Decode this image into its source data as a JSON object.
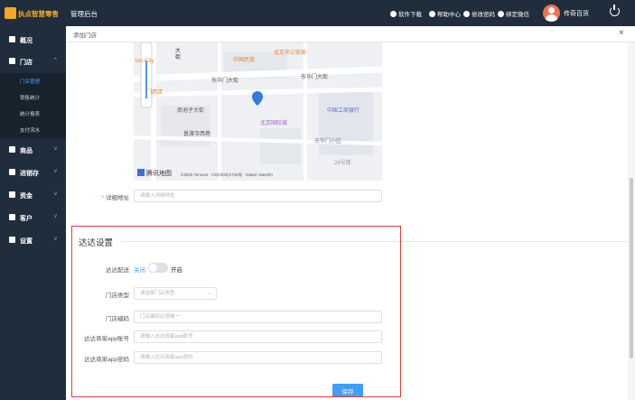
{
  "header": {
    "logo_text": "执点智慧零售",
    "title": "管理后台",
    "links": [
      {
        "label": "软件下载",
        "icon": "download-icon"
      },
      {
        "label": "帮助中心",
        "icon": "help-icon"
      },
      {
        "label": "修改密码",
        "icon": "edit-icon"
      },
      {
        "label": "绑定微信",
        "icon": "wechat-icon"
      }
    ],
    "username": "传奇百货"
  },
  "sidebar": {
    "items": [
      {
        "label": "概况",
        "icon": "home-icon"
      },
      {
        "label": "门店",
        "icon": "store-icon",
        "expanded": true,
        "chevron": "^"
      },
      {
        "label": "商品",
        "icon": "goods-icon",
        "chevron": "v"
      },
      {
        "label": "进销存",
        "icon": "inventory-icon",
        "chevron": "v"
      },
      {
        "label": "资金",
        "icon": "money-icon",
        "chevron": "v"
      },
      {
        "label": "客户",
        "icon": "customer-icon",
        "chevron": "v"
      },
      {
        "label": "设置",
        "icon": "settings-icon",
        "chevron": "v"
      }
    ],
    "subitems": [
      {
        "label": "门店管理",
        "active": true
      },
      {
        "label": "销售统计"
      },
      {
        "label": "统计报表"
      },
      {
        "label": "支付流水"
      }
    ]
  },
  "tab": {
    "label": "添加门店",
    "close": "×"
  },
  "map": {
    "labels": [
      "大",
      "街",
      "ton City",
      "门西店",
      "北京市公安局",
      "中国民族",
      "东华门大街",
      "东华门大街",
      "南池子大街",
      "普渡寺西巷",
      "中国工商银行",
      "北京国际城",
      "东华门小区",
      "24号楼"
    ],
    "brand": "腾讯地图",
    "copyright": "©2020 Tencent · GS(2020)1728号 · Data© NavInfo"
  },
  "form": {
    "address": {
      "label": "详细地址",
      "placeholder": "请输入详细地址"
    }
  },
  "dada": {
    "section_title": "达达设置",
    "delivery_label": "达达配送",
    "toggle_off": "关闭",
    "toggle_on": "开启",
    "store_type_label": "门店类型",
    "store_type_placeholder": "请选择门店类型",
    "store_code_label": "门店编码",
    "store_code_placeholder": "门店编码必须唯一",
    "account_label": "达达商家app账号",
    "account_placeholder": "请输入达达商家app账号",
    "password_label": "达达商家app密码",
    "password_placeholder": "请输入达达商家app密码",
    "save_label": "保存"
  }
}
